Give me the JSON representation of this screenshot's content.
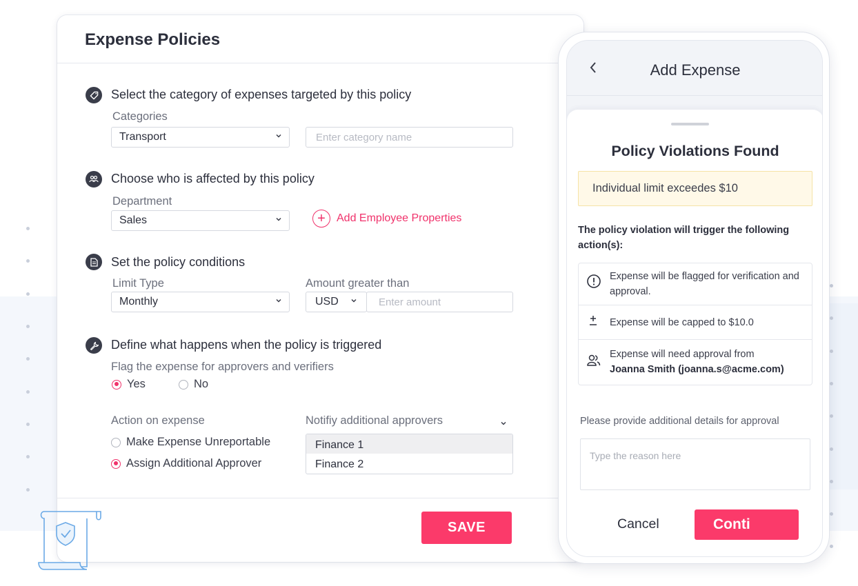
{
  "policies": {
    "title": "Expense Policies",
    "sections": {
      "category": {
        "icon": "tag-icon",
        "title": "Select the category of expenses targeted by this policy",
        "label": "Categories",
        "selected": "Transport",
        "input_placeholder": "Enter category name"
      },
      "affected": {
        "icon": "people-icon",
        "title": "Choose who is affected by this policy",
        "label": "Department",
        "selected": "Sales",
        "add_link": "Add Employee Properties"
      },
      "conditions": {
        "icon": "document-icon",
        "title": "Set the policy conditions",
        "limit_label": "Limit Type",
        "limit_selected": "Monthly",
        "amount_label": "Amount greater than",
        "currency": "USD",
        "amount_placeholder": "Enter amount"
      },
      "trigger": {
        "icon": "wrench-icon",
        "title": "Define what happens when the policy is triggered",
        "flag_label": "Flag the expense for approvers and verifiers",
        "flag_yes": "Yes",
        "flag_no": "No",
        "action_label": "Action on expense",
        "action_unreportable": "Make Expense Unreportable",
        "action_assign": "Assign Additional Approver",
        "notify_label": "Notifiy additional approvers",
        "approvers": [
          "Finance 1",
          "Finance 2"
        ]
      }
    },
    "save_label": "SAVE"
  },
  "phone": {
    "title": "Add Expense",
    "sheet_title": "Policy Violations Found",
    "violation": "Individual limit exceedes $10",
    "trigger_text": "The policy violation will trigger the following action(s):",
    "actions": [
      {
        "icon": "alert-circle-icon",
        "text": "Expense will be flagged for verification and approval."
      },
      {
        "icon": "plus-minus-icon",
        "text": "Expense will be capped to $10.0"
      },
      {
        "icon": "users-icon",
        "text": "Expense will need approval from",
        "bold": "Joanna Smith (joanna.s@acme.com)"
      }
    ],
    "details_label": "Please provide additional details for approval",
    "reason_placeholder": "Type the reason here",
    "cancel_label": "Cancel",
    "continue_label": "Conti"
  },
  "colors": {
    "accent": "#fb3a6a",
    "link": "#f0326b",
    "warning_bg": "#fff9e8"
  }
}
